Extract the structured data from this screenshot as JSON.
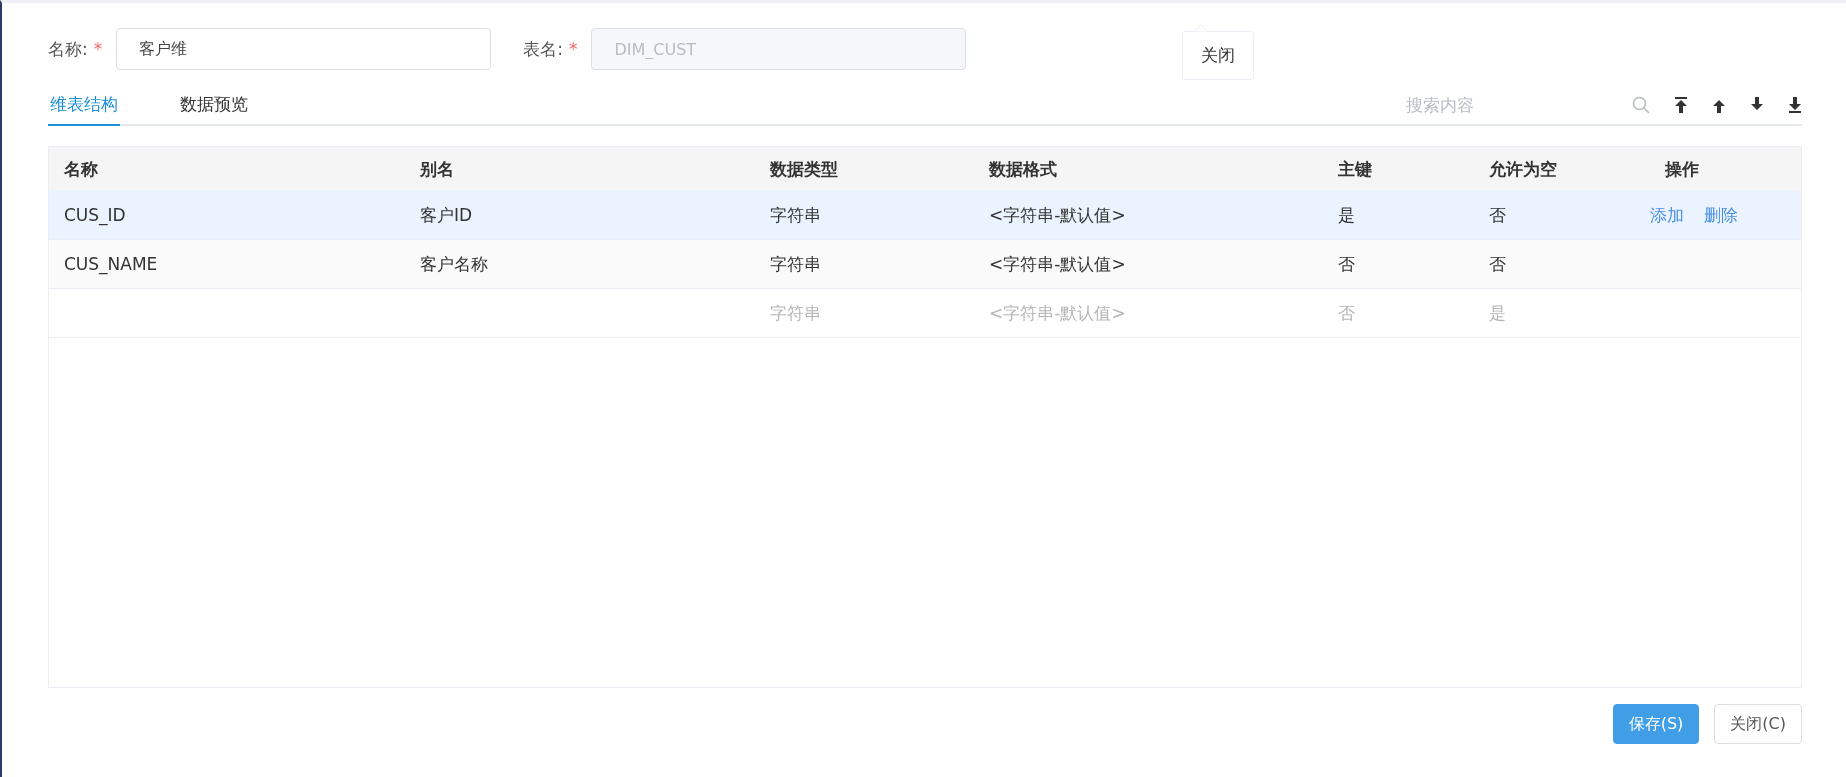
{
  "form": {
    "name_label": "名称:",
    "name_mark": "*",
    "name_value": "客户维",
    "table_label": "表名:",
    "table_mark": "*",
    "table_value": "DIM_CUST",
    "table_disabled": true
  },
  "tooltip": {
    "text": "关闭"
  },
  "tabs": [
    {
      "label": "维表结构",
      "selected": true
    },
    {
      "label": "数据预览",
      "selected": false
    }
  ],
  "search": {
    "placeholder": "搜索内容"
  },
  "table": {
    "columns": [
      "名称",
      "别名",
      "数据类型",
      "数据格式",
      "主键",
      "允许为空",
      "操作"
    ],
    "rows": [
      {
        "kind": "data",
        "selected": true,
        "cells": [
          "CUS_ID",
          "客户ID",
          "字符串",
          "<字符串-默认值>",
          "是",
          "否"
        ],
        "actions": [
          "添加",
          "删除"
        ]
      },
      {
        "kind": "data",
        "selected": false,
        "cells": [
          "CUS_NAME",
          "客户名称",
          "字符串",
          "<字符串-默认值>",
          "否",
          "否"
        ]
      },
      {
        "kind": "new",
        "selected": false,
        "cells": [
          "",
          "",
          "字符串",
          "<字符串-默认值>",
          "否",
          "是"
        ]
      }
    ]
  },
  "buttons": [
    {
      "label": "保存(S)",
      "kind": "primary"
    },
    {
      "label": "关闭(C)",
      "kind": "default"
    }
  ]
}
